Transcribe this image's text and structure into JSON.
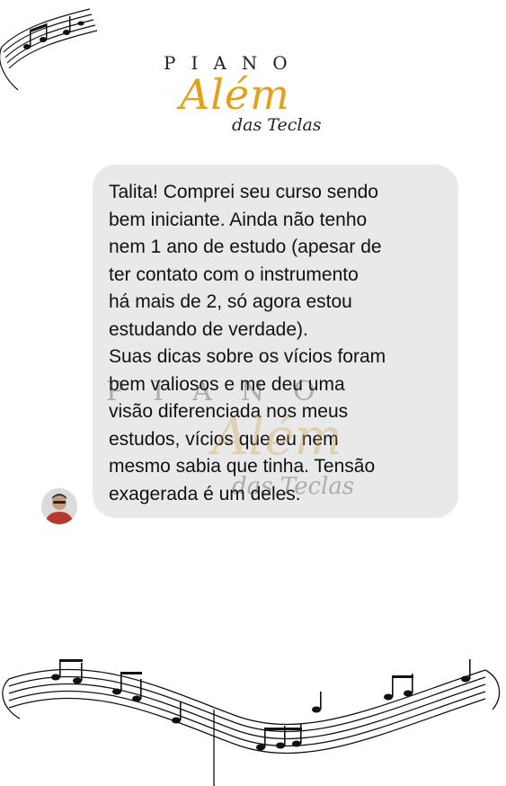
{
  "logo": {
    "top_word": "PIANO",
    "main_word": "Além",
    "sub_words": "das Teclas",
    "accent_color": "#e0a21a"
  },
  "message": {
    "text": "Talita! Comprei seu curso sendo\nbem iniciante. Ainda não tenho\nnem 1 ano de estudo (apesar de\nter contato com o instrumento\nhá mais de 2, só agora estou\nestudando de verdade).\nSuas dicas sobre os vícios foram\nbem valiosos e me deu uma\nvisão diferenciada nos meus\nestudos, vícios que eu nem\nmesmo sabia que tinha. Tensão\nexagerada é um deles.",
    "bubble_color": "#e9e9eb"
  },
  "icons": {
    "top_decoration": "music-staff-icon",
    "bottom_decoration": "music-staff-icon",
    "avatar": "user-avatar"
  }
}
